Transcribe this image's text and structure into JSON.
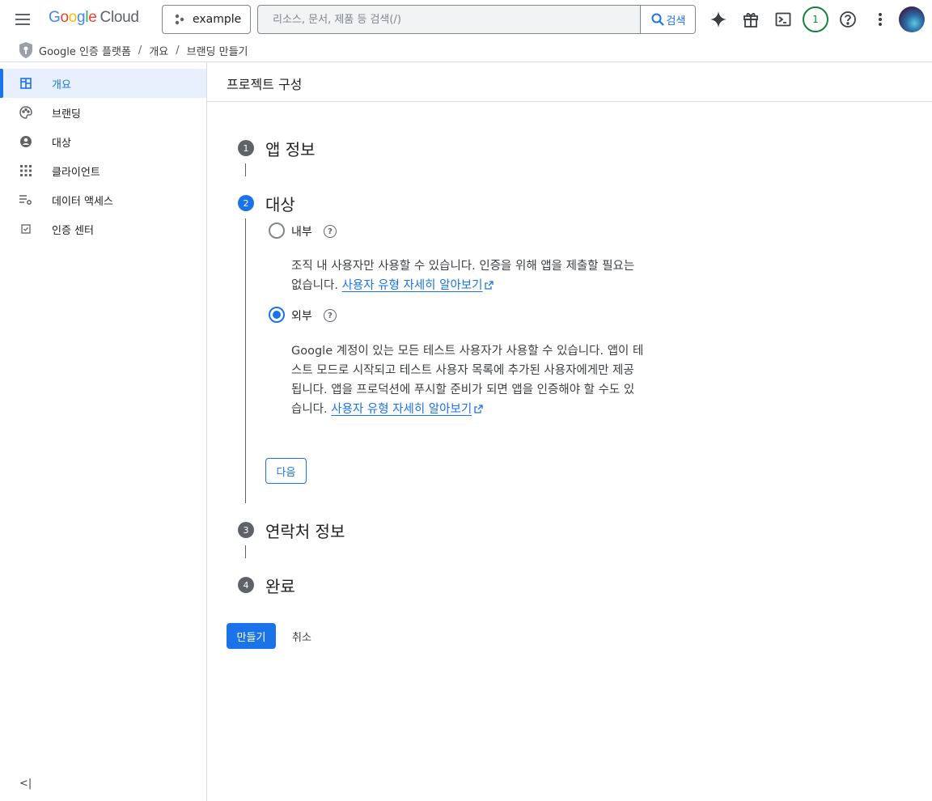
{
  "header": {
    "logo": {
      "letters": [
        "G",
        "o",
        "o",
        "g",
        "l",
        "e"
      ],
      "cloud": "Cloud"
    },
    "project": {
      "label": "example",
      "icon": "project-hierarchy-icon"
    },
    "search": {
      "placeholder": "리소스, 문서, 제품 등 검색(/)",
      "value": "",
      "button_label": "검색"
    },
    "icons": [
      "gemini-spark-icon",
      "gift-icon",
      "terminal-icon",
      "notifications-icon",
      "help-icon",
      "more-vert-icon"
    ],
    "notification_count": "1"
  },
  "breadcrumb": {
    "product": "Google 인증 플랫폼",
    "items": [
      "개요",
      "브랜딩 만들기"
    ]
  },
  "sidebar": {
    "items": [
      {
        "label": "개요",
        "icon": "dashboard-icon",
        "active": true
      },
      {
        "label": "브랜딩",
        "icon": "palette-icon",
        "active": false
      },
      {
        "label": "대상",
        "icon": "account-circle-icon",
        "active": false
      },
      {
        "label": "클라이언트",
        "icon": "apps-grid-icon",
        "active": false
      },
      {
        "label": "데이터 액세스",
        "icon": "list-settings-icon",
        "active": false
      },
      {
        "label": "인증 센터",
        "icon": "verified-checkbox-icon",
        "active": false
      }
    ],
    "collapse_label": "<|"
  },
  "page": {
    "title": "프로젝트 구성",
    "steps": [
      {
        "num": "1",
        "title": "앱 정보"
      },
      {
        "num": "2",
        "title": "대상"
      },
      {
        "num": "3",
        "title": "연락처 정보"
      },
      {
        "num": "4",
        "title": "완료"
      }
    ],
    "audience": {
      "internal": {
        "label": "내부",
        "selected": false,
        "desc_line1": "조직 내 사용자만 사용할 수 있습니다. 인증을 위해 앱을 제출할 필요는",
        "desc_line2": "없습니다.",
        "link": "사용자 유형 자세히 알아보기"
      },
      "external": {
        "label": "외부",
        "selected": true,
        "desc_line1": "Google 계정이 있는 모든 테스트 사용자가 사용할 수 있습니다. 앱이 테",
        "desc_line2": "스트 모드로 시작되고 테스트 사용자 목록에 추가된 사용자에게만 제공",
        "desc_line3": "됩니다. 앱을 프로덕션에 푸시할 준비가 되면 앱을 인증해야 할 수도 있",
        "desc_line4": "습니다.",
        "link": "사용자 유형 자세히 알아보기"
      },
      "next_label": "다음"
    },
    "create_label": "만들기",
    "cancel_label": "취소"
  },
  "colors": {
    "accent": "#1a73e8",
    "border": "#dadce0",
    "text": "#202124",
    "notif": "#188038"
  }
}
